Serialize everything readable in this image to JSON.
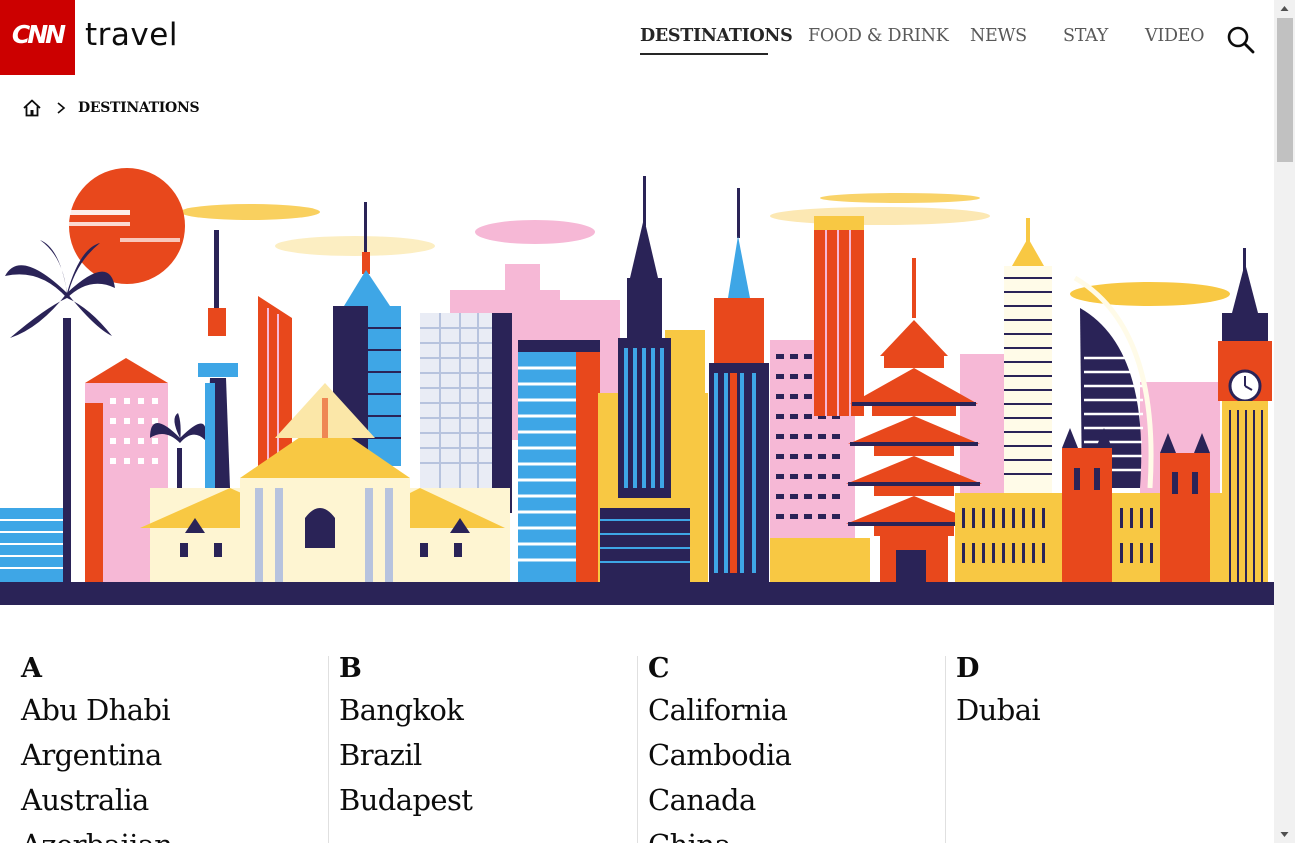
{
  "header": {
    "logo_text": "CNN",
    "brand": "travel",
    "nav": [
      {
        "label": "DESTINATIONS",
        "active": true
      },
      {
        "label": "FOOD & DRINK",
        "active": false
      },
      {
        "label": "NEWS",
        "active": false
      },
      {
        "label": "STAY",
        "active": false
      },
      {
        "label": "VIDEO",
        "active": false
      }
    ],
    "search_icon": "search-icon"
  },
  "breadcrumb": {
    "home_icon": "home-icon",
    "separator_icon": "chevron-right-icon",
    "current": "DESTINATIONS"
  },
  "hero": {
    "description_icon": "city-skyline-illustration"
  },
  "directory": [
    {
      "letter": "A",
      "items": [
        "Abu Dhabi",
        "Argentina",
        "Australia",
        "Azerbaijan"
      ]
    },
    {
      "letter": "B",
      "items": [
        "Bangkok",
        "Brazil",
        "Budapest"
      ]
    },
    {
      "letter": "C",
      "items": [
        "California",
        "Cambodia",
        "Canada",
        "China"
      ]
    },
    {
      "letter": "D",
      "items": [
        "Dubai"
      ]
    }
  ],
  "colors": {
    "brand_red": "#cc0000",
    "text": "#0c0c0c",
    "nav_inactive": "#595959",
    "navy": "#2a2357",
    "orange": "#e8481c",
    "sky_blue": "#3ea6e6",
    "pink": "#f6b8d6",
    "yellow": "#f8c843"
  }
}
